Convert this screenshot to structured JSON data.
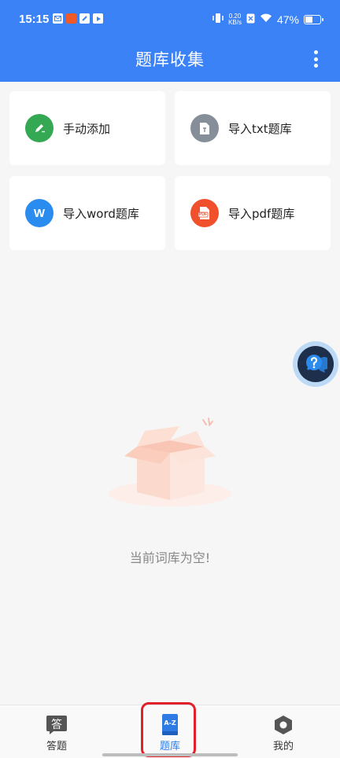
{
  "status_bar": {
    "time": "15:15",
    "network_speed_value": "0.20",
    "network_speed_unit": "KB/s",
    "battery": "47%"
  },
  "header": {
    "title": "题库收集"
  },
  "actions": [
    {
      "label": "手动添加",
      "icon": "pencil-icon",
      "color": "#34a853"
    },
    {
      "label": "导入txt题库",
      "icon": "text-file-icon",
      "color": "#858e99"
    },
    {
      "label": "导入word题库",
      "icon": "word-icon",
      "icon_text": "W",
      "color": "#2b8cf0"
    },
    {
      "label": "导入pdf题库",
      "icon": "pdf-icon",
      "icon_text": "PDF",
      "color": "#f0502b"
    }
  ],
  "empty_state": {
    "message": "当前词库为空!"
  },
  "tabbar": {
    "tabs": [
      {
        "label": "答题",
        "icon": "answer-icon",
        "icon_text": "答"
      },
      {
        "label": "题库",
        "icon": "az-book-icon",
        "icon_text": "A-Z",
        "active": true
      },
      {
        "label": "我的",
        "icon": "hexagon-icon"
      }
    ]
  },
  "colors": {
    "primary": "#3b82f6",
    "highlight_box": "#e0202a"
  }
}
